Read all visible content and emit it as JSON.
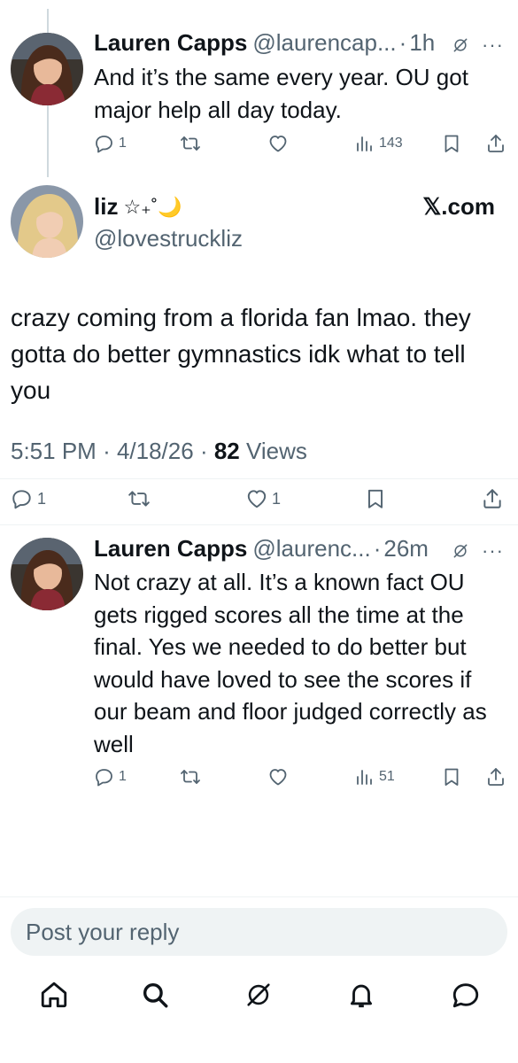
{
  "tweets": [
    {
      "name": "Lauren Capps",
      "handle": "@laurencap...",
      "time": "1h",
      "text": "And it’s the same every year. OU got major help all day today.",
      "replies": "1",
      "views": "143",
      "avatar_icon": "user-avatar"
    },
    {
      "name": "Lauren Capps",
      "handle": "@laurenc...",
      "time": "26m",
      "text": "Not crazy at all. It’s a known fact OU gets rigged scores all the time at the final. Yes we needed to do better but would have loved to see the scores if our beam and floor judged correctly as well",
      "replies": "1",
      "views": "51",
      "avatar_icon": "user-avatar"
    }
  ],
  "main_post": {
    "name": "liz",
    "name_decoration": "☆₊˚🌙",
    "handle": "@lovestruckliz",
    "watermark": "𝕏.com",
    "text": "crazy coming from a florida fan lmao. they gotta do better gymnastics idk what to tell you",
    "time": "5:51 PM",
    "date": "4/18/26",
    "views_count": "82",
    "views_label": "Views",
    "replies": "1",
    "likes": "1"
  },
  "reply_box": {
    "placeholder": "Post your reply"
  },
  "nav": {
    "items": [
      "home-icon",
      "search-icon",
      "grok-icon",
      "notifications-icon",
      "messages-icon"
    ]
  },
  "colors": {
    "text": "#0f1419",
    "secondary": "#536471",
    "divider": "#eff3f4",
    "input_bg": "#eff3f4"
  }
}
